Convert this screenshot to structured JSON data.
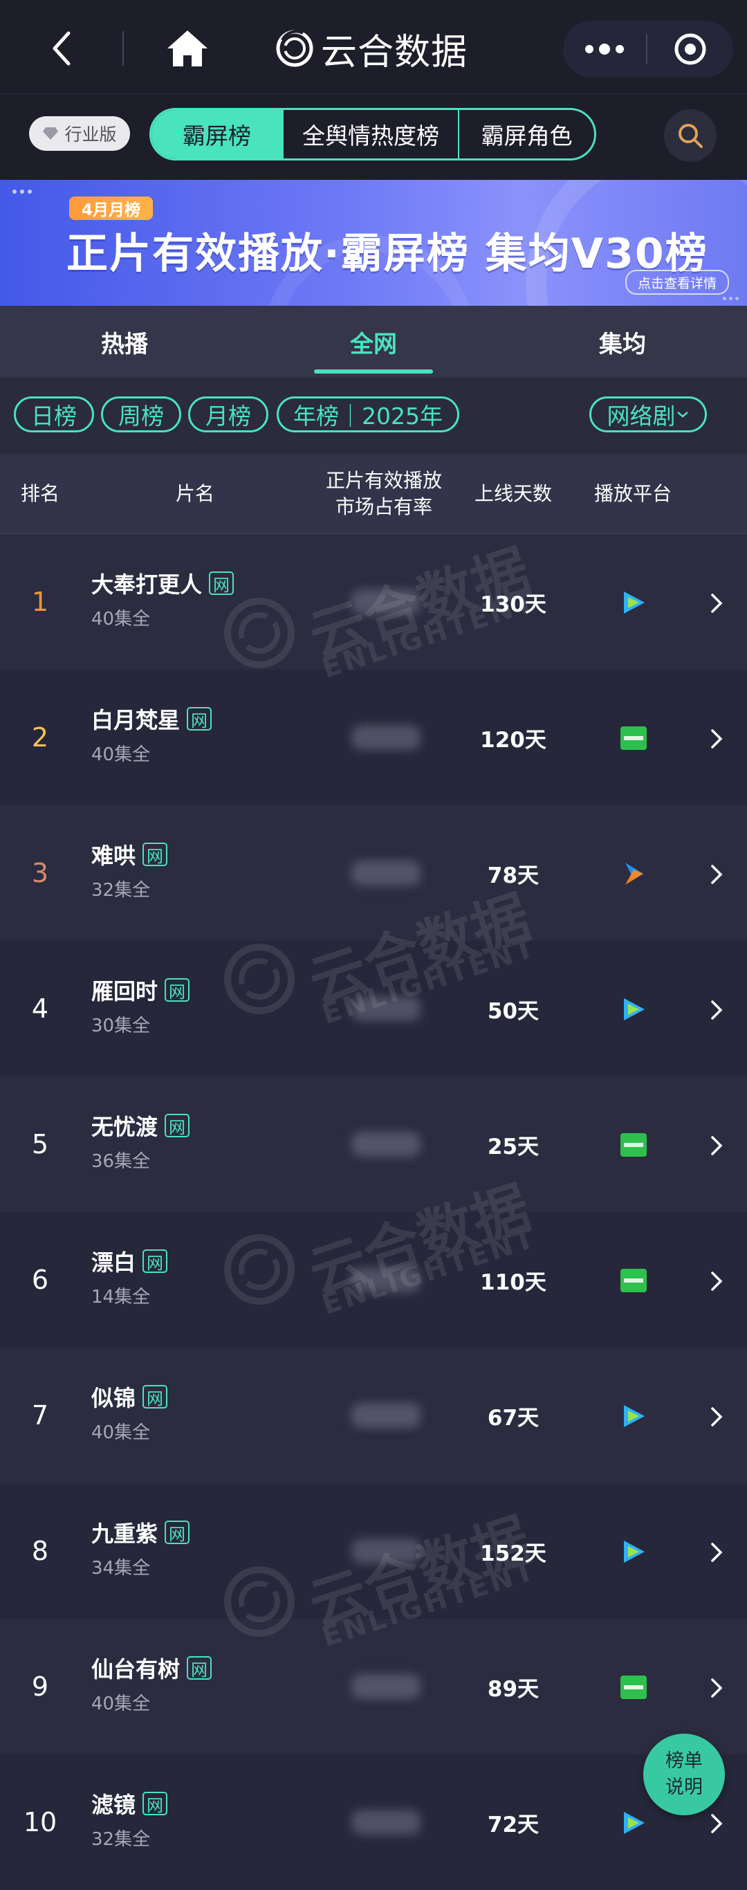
{
  "app": {
    "brand": "云合数据"
  },
  "filters": {
    "edition": "行业版",
    "segments": [
      "霸屏榜",
      "全舆情热度榜",
      "霸屏角色"
    ]
  },
  "banner": {
    "tag": "4月月榜",
    "title": "正片有效播放·霸屏榜 集均V30榜",
    "detail": "点击查看详情"
  },
  "tabs": [
    "热播",
    "全网",
    "集均"
  ],
  "chips": {
    "day": "日榜",
    "week": "周榜",
    "month": "月榜",
    "year": "年榜｜2025年",
    "genre": "网络剧"
  },
  "table": {
    "headers": {
      "rank": "排名",
      "title": "片名",
      "share_line1": "正片有效播放",
      "share_line2": "市场占有率",
      "days": "上线天数",
      "platform": "播放平台"
    },
    "badge": "网",
    "rows": [
      {
        "rank": "1",
        "title": "大奉打更人",
        "episodes": "40集全",
        "days": "130天",
        "platform": "tencent"
      },
      {
        "rank": "2",
        "title": "白月梵星",
        "episodes": "40集全",
        "days": "120天",
        "platform": "iqiyi"
      },
      {
        "rank": "3",
        "title": "难哄",
        "episodes": "32集全",
        "days": "78天",
        "platform": "youku"
      },
      {
        "rank": "4",
        "title": "雁回时",
        "episodes": "30集全",
        "days": "50天",
        "platform": "tencent"
      },
      {
        "rank": "5",
        "title": "无忧渡",
        "episodes": "36集全",
        "days": "25天",
        "platform": "iqiyi"
      },
      {
        "rank": "6",
        "title": "漂白",
        "episodes": "14集全",
        "days": "110天",
        "platform": "iqiyi"
      },
      {
        "rank": "7",
        "title": "似锦",
        "episodes": "40集全",
        "days": "67天",
        "platform": "tencent"
      },
      {
        "rank": "8",
        "title": "九重紫",
        "episodes": "34集全",
        "days": "152天",
        "platform": "tencent"
      },
      {
        "rank": "9",
        "title": "仙台有树",
        "episodes": "40集全",
        "days": "89天",
        "platform": "iqiyi"
      },
      {
        "rank": "10",
        "title": "滤镜",
        "episodes": "32集全",
        "days": "72天",
        "platform": "tencent"
      }
    ]
  },
  "fab": {
    "line1": "榜单",
    "line2": "说明"
  },
  "watermark": {
    "main": "云合数据",
    "sub": "ENLIGHTENT"
  },
  "colors": {
    "accent": "#49e3be",
    "rank1": "#f0923a",
    "rank2": "#f2c25a",
    "rank3": "#d98a6a",
    "tencent": "#2fb1f5",
    "iqiyi": "#2ec04d",
    "youku": "#1e8ff5"
  }
}
